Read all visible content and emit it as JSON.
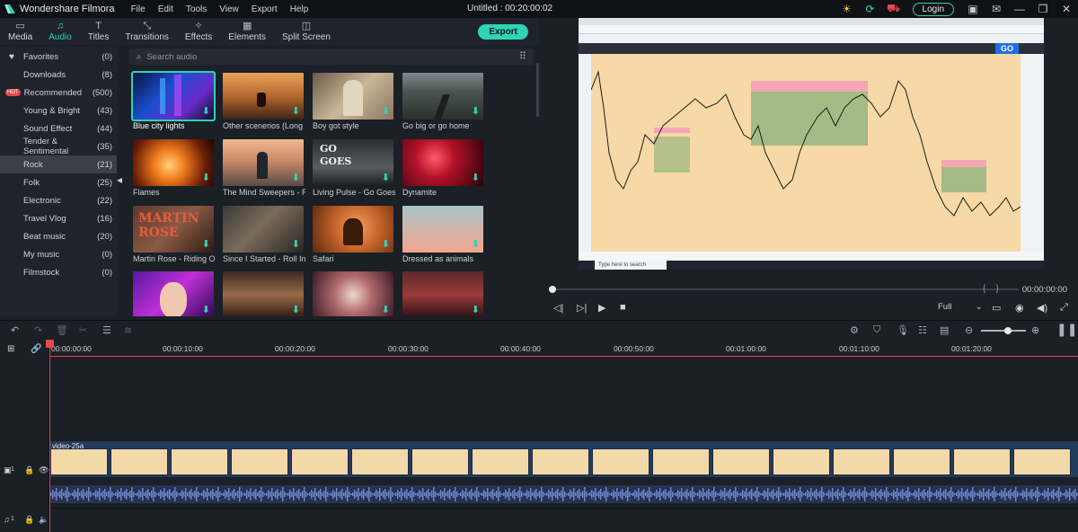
{
  "titlebar": {
    "app_name": "Wondershare Filmora",
    "menu": [
      "File",
      "Edit",
      "Tools",
      "View",
      "Export",
      "Help"
    ],
    "document_title": "Untitled : 00:20:00:02",
    "login_label": "Login"
  },
  "tabs": [
    {
      "label": "Media",
      "icon": "folder-icon"
    },
    {
      "label": "Audio",
      "icon": "music-note-icon",
      "active": true
    },
    {
      "label": "Titles",
      "icon": "text-icon"
    },
    {
      "label": "Transitions",
      "icon": "transition-icon"
    },
    {
      "label": "Effects",
      "icon": "effects-icon"
    },
    {
      "label": "Elements",
      "icon": "elements-icon"
    },
    {
      "label": "Split Screen",
      "icon": "split-screen-icon"
    }
  ],
  "export_label": "Export",
  "categories": [
    {
      "label": "Favorites",
      "count": "(0)"
    },
    {
      "label": "Downloads",
      "count": "(8)"
    },
    {
      "label": "Recommended",
      "count": "(500)",
      "badge": "HOT"
    },
    {
      "label": "Young & Bright",
      "count": "(43)"
    },
    {
      "label": "Sound Effect",
      "count": "(44)"
    },
    {
      "label": "Tender & Sentimental",
      "count": "(35)"
    },
    {
      "label": "Rock",
      "count": "(21)",
      "active": true
    },
    {
      "label": "Folk",
      "count": "(25)"
    },
    {
      "label": "Electronic",
      "count": "(22)"
    },
    {
      "label": "Travel Vlog",
      "count": "(16)"
    },
    {
      "label": "Beat music",
      "count": "(20)"
    },
    {
      "label": "My music",
      "count": "(0)"
    },
    {
      "label": "Filmstock",
      "count": "(0)"
    }
  ],
  "search": {
    "placeholder": "Search audio"
  },
  "media_items": [
    {
      "caption": "Blue city lights",
      "selected": true
    },
    {
      "caption": "Other scenerios  (Long i..."
    },
    {
      "caption": "Boy got style"
    },
    {
      "caption": "Go big or go home"
    },
    {
      "caption": "Flames"
    },
    {
      "caption": "The Mind Sweepers - R..."
    },
    {
      "caption": "Living Pulse - Go Goes",
      "overlay": "GO GOES"
    },
    {
      "caption": "Dynamite"
    },
    {
      "caption": "Martin Rose - Riding On",
      "overlay": "MARTIN ROSE"
    },
    {
      "caption": "Since I Started - Roll In ..."
    },
    {
      "caption": "Safari"
    },
    {
      "caption": "Dressed as animals"
    },
    {
      "caption": ""
    },
    {
      "caption": ""
    },
    {
      "caption": ""
    },
    {
      "caption": ""
    }
  ],
  "preview": {
    "time": "00:00:00:00",
    "quality": "Full",
    "go_label": "GO",
    "search_taskbar": "Type here to search"
  },
  "timeline": {
    "ruler": [
      "00:00:00:00",
      "00:00:10:00",
      "00:00:20:00",
      "00:00:30:00",
      "00:00:40:00",
      "00:00:50:00",
      "00:01:00:00",
      "00:01:10:00",
      "00:01:20:00"
    ],
    "video_clip_label": "video-25a",
    "video_track_index": "1",
    "audio_track_index": "1"
  },
  "colors": {
    "accent": "#2fd3b5",
    "playhead": "#e5484d",
    "hot_badge": "#e5484d"
  }
}
